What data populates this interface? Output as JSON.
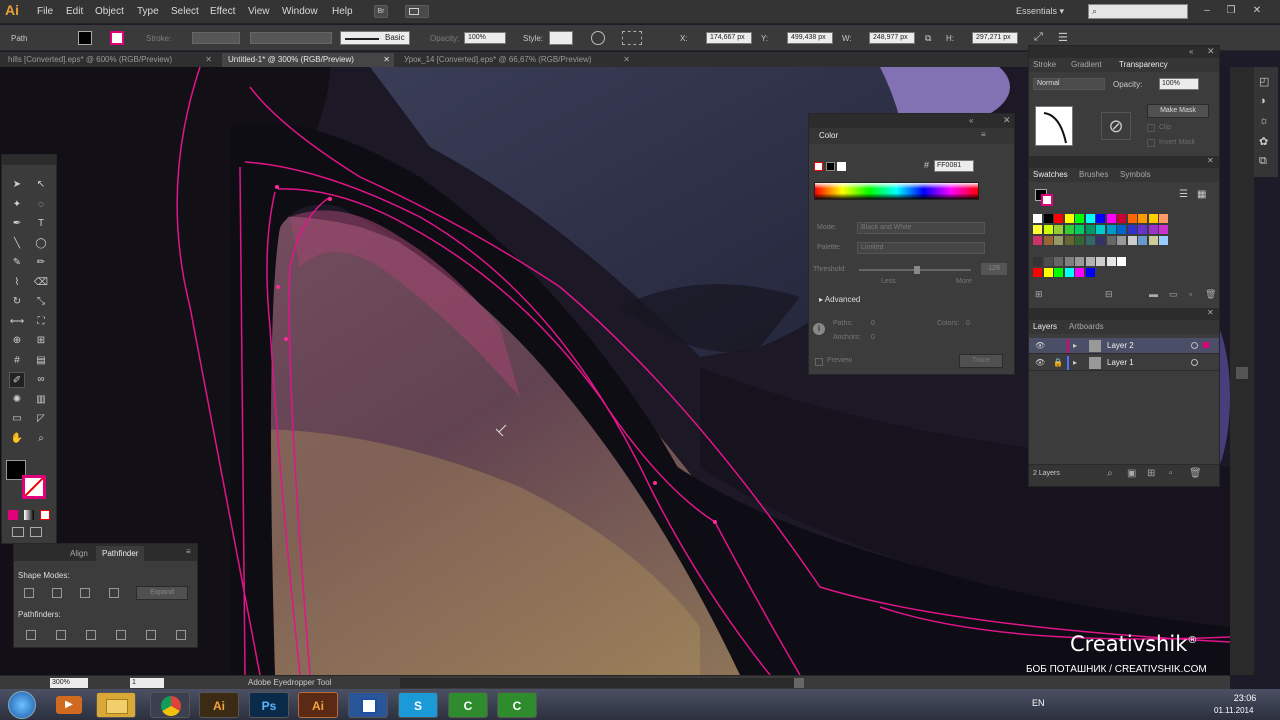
{
  "app": {
    "logo": "Ai"
  },
  "menu": [
    "File",
    "Edit",
    "Object",
    "Type",
    "Select",
    "Effect",
    "View",
    "Window",
    "Help"
  ],
  "workspace": {
    "label": "Essentials"
  },
  "window_controls": {
    "minimize": "–",
    "restore": "❐",
    "close": "✕"
  },
  "control_bar": {
    "selection_label": "Path",
    "stroke_label": "Stroke:",
    "brush_label": "Basic",
    "opacity_label": "Opacity:",
    "opacity_value": "100%",
    "style_label": "Style:",
    "x_label": "X:",
    "x_value": "174,667 px",
    "y_label": "Y:",
    "y_value": "499,438 px",
    "w_label": "W:",
    "w_value": "248,977 px",
    "h_label": "H:",
    "h_value": "297,271 px"
  },
  "tabs": [
    {
      "label": "hills [Converted].eps* @ 600% (RGB/Preview)",
      "active": false
    },
    {
      "label": "Untitled-1* @ 300% (RGB/Preview)",
      "active": true
    },
    {
      "label": "Урок_14 [Converted].eps* @ 66,67% (RGB/Preview)",
      "active": false
    }
  ],
  "color_panel": {
    "title": "Color",
    "hex": "FF0081",
    "mode_label": "Mode:",
    "mode_value": "Black and White",
    "palette_label": "Palette:",
    "palette_value": "Limited",
    "threshold_label": "Threshold:",
    "threshold_value": "128",
    "less_label": "Less",
    "more_label": "More",
    "advanced_label": "Advanced",
    "paths_label": "Paths:",
    "paths_value": "0",
    "colors_label": "Colors:",
    "colors_value": "0",
    "anchors_label": "Anchors:",
    "anchors_value": "0",
    "preview_label": "Preview",
    "trace_label": "Trace",
    "spectrum_colors": [
      "#ff0000",
      "#ffff00",
      "#00ff00",
      "#00ffff",
      "#0000ff",
      "#ff00ff",
      "#ff0000"
    ]
  },
  "transparency_panel": {
    "tabs": [
      "Stroke",
      "Gradient",
      "Transparency"
    ],
    "active_tab": "Transparency",
    "blend_mode": "Normal",
    "opacity_label": "Opacity:",
    "opacity_value": "100%",
    "make_mask": "Make Mask",
    "clip": "Clip",
    "invert_mask": "Invert Mask"
  },
  "swatches_panel": {
    "tabs": [
      "Swatches",
      "Brushes",
      "Symbols"
    ],
    "active_tab": "Swatches",
    "colors": [
      [
        "#ffffff",
        "#000000",
        "#ff0000",
        "#ffff00",
        "#00ff00",
        "#00ffff",
        "#0000ff",
        "#ff00ff",
        "#cc0033",
        "#ff6600",
        "#ff9900",
        "#ffcc00",
        "#ff9966"
      ],
      [
        "#ffff33",
        "#ccff00",
        "#99cc33",
        "#33cc33",
        "#00cc66",
        "#009966",
        "#00cccc",
        "#0099cc",
        "#0066cc",
        "#3333cc",
        "#6633cc",
        "#9933cc",
        "#cc33cc"
      ],
      [
        "#cc3366",
        "#996633",
        "#999966",
        "#666633",
        "#336633",
        "#336666",
        "#333366",
        "#666666",
        "#999999",
        "#cccccc",
        "#6699cc",
        "#cccc99",
        "#99ccff"
      ],
      [
        "#333333",
        "#4d4d4d",
        "#666666",
        "#808080",
        "#999999",
        "#b3b3b3",
        "#cccccc",
        "#e6e6e6",
        "#ffffff"
      ],
      [
        "#ff0000",
        "#ffff00",
        "#00ff00",
        "#00ffff",
        "#ff00ff",
        "#0000ff"
      ]
    ]
  },
  "layers_panel": {
    "tabs": [
      "Layers",
      "Artboards"
    ],
    "active_tab": "Layers",
    "layers": [
      {
        "name": "Layer 2",
        "color": "#e0007a",
        "selected": true
      },
      {
        "name": "Layer 1",
        "color": "#4f6fff",
        "selected": false
      }
    ],
    "count_label": "2 Layers"
  },
  "pathfinder_panel": {
    "tabs": [
      "Align",
      "Pathfinder"
    ],
    "active_tab": "Pathfinder",
    "shape_modes_label": "Shape Modes:",
    "expand_label": "Expand",
    "pathfinders_label": "Pathfinders:"
  },
  "status_bar": {
    "zoom": "300%",
    "page": "1",
    "tool_label": "Adobe Eyedropper Tool"
  },
  "watermark": {
    "brand": "Creativshik",
    "mark": "®",
    "subtitle": "БОБ ПОТАШНИК / CREATIVSHIK.COM"
  },
  "taskbar": {
    "language": "EN",
    "time": "23:06",
    "date": "01.11.2014",
    "apps": [
      {
        "name": "explorer",
        "label": "",
        "bg": "#d9a937"
      },
      {
        "name": "chrome",
        "label": "",
        "bg": "#3b3f50"
      },
      {
        "name": "illustrator-1",
        "label": "Ai",
        "bg": "#3b2a14"
      },
      {
        "name": "photoshop",
        "label": "Ps",
        "bg": "#0a2a4a"
      },
      {
        "name": "illustrator-2",
        "label": "Ai",
        "bg": "#5a2a14"
      },
      {
        "name": "word",
        "label": "",
        "bg": "#2a5599"
      },
      {
        "name": "skype",
        "label": "S",
        "bg": "#1a9ad6"
      },
      {
        "name": "camtasia-1",
        "label": "C",
        "bg": "#2e8b2e"
      },
      {
        "name": "camtasia-2",
        "label": "C",
        "bg": "#2e8b2e"
      }
    ]
  }
}
